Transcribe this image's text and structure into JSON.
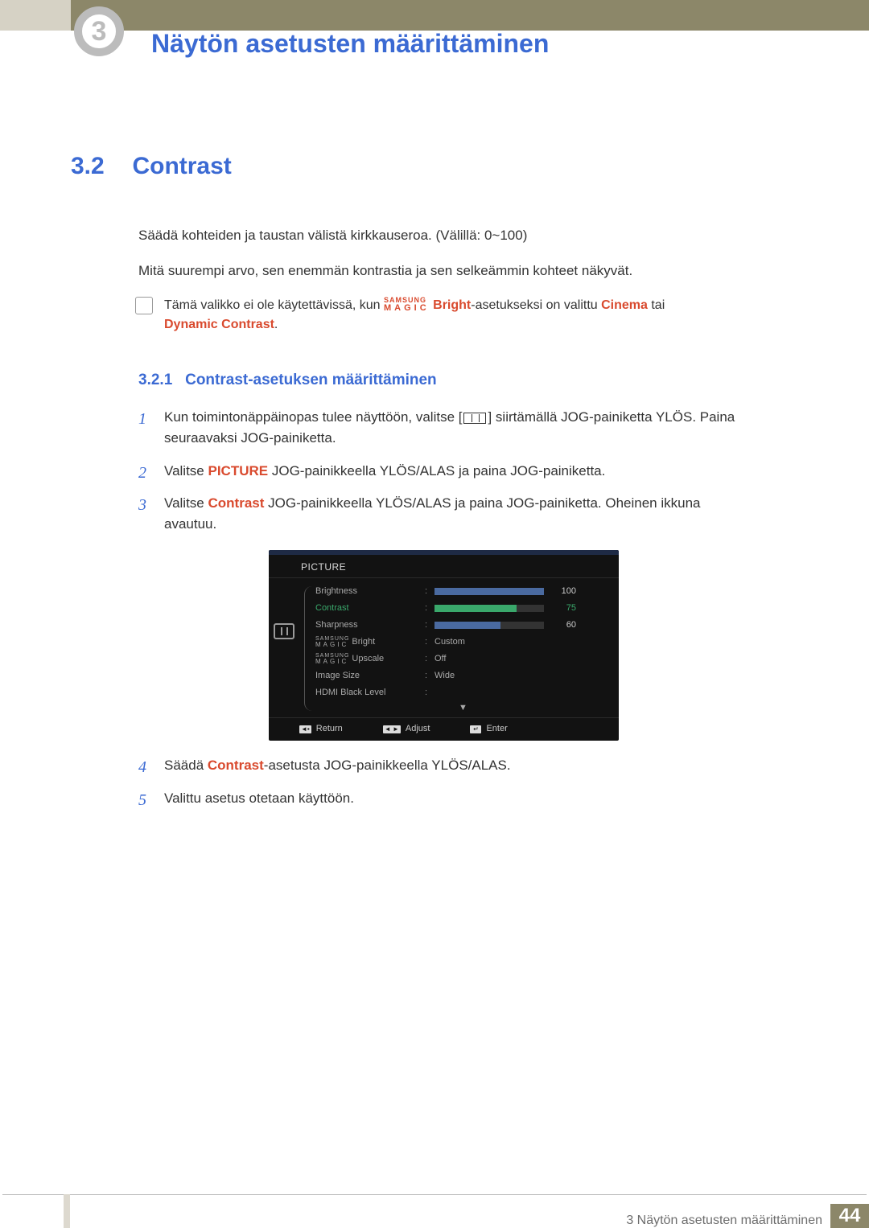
{
  "header": {
    "chapter_number": "3",
    "title": "Näytön asetusten määrittäminen"
  },
  "section": {
    "number": "3.2",
    "title": "Contrast"
  },
  "intro": {
    "p1": "Säädä kohteiden ja taustan välistä kirkkauseroa. (Välillä: 0~100)",
    "p2": "Mitä suurempi arvo, sen enemmän kontrastia ja sen selkeämmin kohteet näkyvät."
  },
  "note": {
    "pre": "Tämä valikko ei ole käytettävissä, kun ",
    "magic_top": "SAMSUNG",
    "magic_bot": "MAGIC",
    "bright": "Bright",
    "mid": "-asetukseksi on valittu ",
    "cinema": "Cinema",
    "or": " tai ",
    "dyn": "Dynamic Contrast",
    "end": "."
  },
  "subsection": {
    "number": "3.2.1",
    "title": "Contrast-asetuksen määrittäminen"
  },
  "steps": {
    "s1_a": "Kun toimintonäppäinopas tulee näyttöön, valitse [",
    "s1_b": "] siirtämällä JOG-painiketta YLÖS. Paina seuraavaksi JOG-painiketta.",
    "s2_a": "Valitse ",
    "s2_pic": "PICTURE",
    "s2_b": " JOG-painikkeella YLÖS/ALAS ja paina JOG-painiketta.",
    "s3_a": "Valitse ",
    "s3_con": "Contrast",
    "s3_b": " JOG-painikkeella YLÖS/ALAS ja paina JOG-painiketta. Oheinen ikkuna avautuu.",
    "s4_a": "Säädä ",
    "s4_con": "Contrast",
    "s4_b": "-asetusta JOG-painikkeella YLÖS/ALAS.",
    "s5": "Valittu asetus otetaan käyttöön."
  },
  "osd": {
    "title": "PICTURE",
    "rows": {
      "brightness": {
        "label": "Brightness",
        "value": "100",
        "pct": 100
      },
      "contrast": {
        "label": "Contrast",
        "value": "75",
        "pct": 75
      },
      "sharpness": {
        "label": "Sharpness",
        "value": "60",
        "pct": 60
      },
      "magic_bright": {
        "label": "Bright",
        "value": "Custom"
      },
      "magic_upscale": {
        "label": "Upscale",
        "value": "Off"
      },
      "image_size": {
        "label": "Image Size",
        "value": "Wide"
      },
      "hdmi_black": {
        "label": "HDMI Black Level",
        "value": ""
      }
    },
    "magic_top": "SAMSUNG",
    "magic_bot": "MAGIC",
    "footer": {
      "return": "Return",
      "adjust": "Adjust",
      "enter": "Enter"
    }
  },
  "footer": {
    "text": "3 Näytön asetusten määrittäminen",
    "page": "44"
  }
}
